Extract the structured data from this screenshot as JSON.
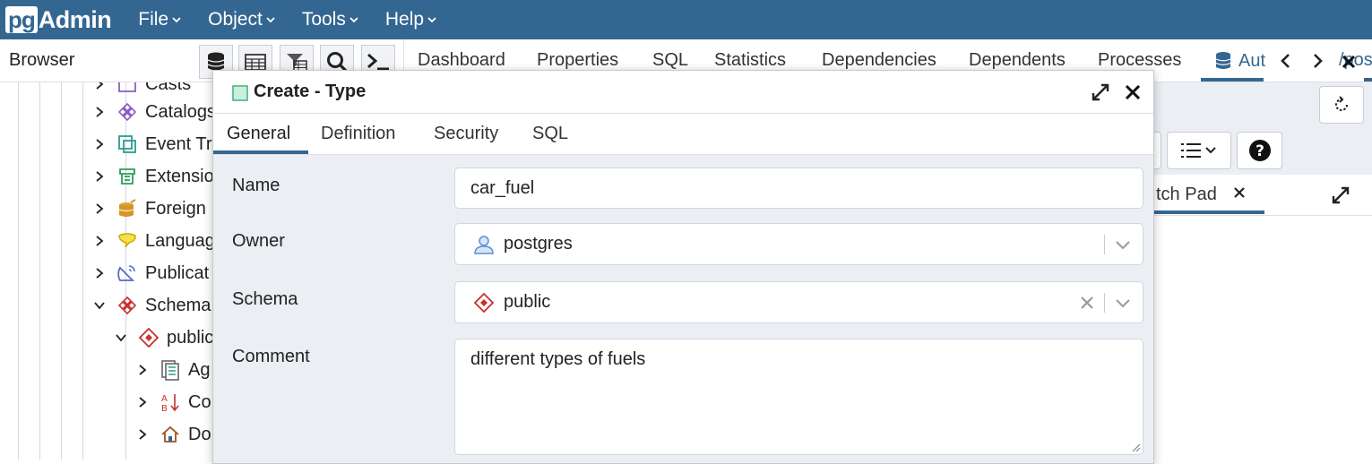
{
  "app": {
    "logo_pg": "pg",
    "logo_admin": "Admin"
  },
  "menu": [
    {
      "label": "File"
    },
    {
      "label": "Object"
    },
    {
      "label": "Tools"
    },
    {
      "label": "Help"
    }
  ],
  "browser": {
    "title": "Browser"
  },
  "main_tabs": {
    "dashboard": "Dashboard",
    "properties": "Properties",
    "sql": "SQL",
    "statistics": "Statistics",
    "dependencies": "Dependencies",
    "dependents": "Dependents",
    "processes": "Processes",
    "query_tab": "Aut",
    "query_tab_extra": "/pos"
  },
  "tree": {
    "casts": "Casts",
    "catalogs": "Catalogs",
    "event_triggers": "Event Tri",
    "extensions": "Extensio",
    "foreign": "Foreign",
    "languages": "Languag",
    "publications": "Publicat",
    "schemas": "Schema",
    "public": "public",
    "aggregates": "Ag",
    "collations": "Co",
    "domains": "Do"
  },
  "right_panel": {
    "scratch_pad": "tch Pad"
  },
  "dialog": {
    "title": "Create - Type",
    "tabs": {
      "general": "General",
      "definition": "Definition",
      "security": "Security",
      "sql": "SQL"
    },
    "fields": {
      "name_label": "Name",
      "name_value": "car_fuel",
      "owner_label": "Owner",
      "owner_value": "postgres",
      "schema_label": "Schema",
      "schema_value": "public",
      "comment_label": "Comment",
      "comment_value": "different types of fuels"
    }
  },
  "colors": {
    "brand": "#336791",
    "panel_bg": "#ebeef3",
    "schema_icon": "#c9302c",
    "user_icon": "#5b8dd6"
  }
}
